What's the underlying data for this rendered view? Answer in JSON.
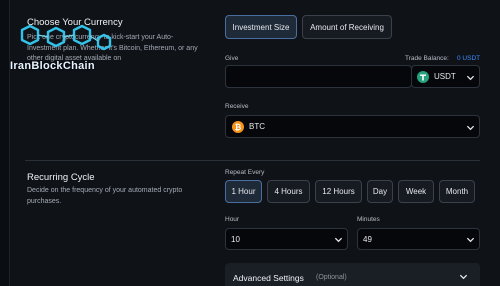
{
  "currency": {
    "title": "Choose Your Currency",
    "description": "Pick one cryptocurrency to kick-start your Auto-Investment plan. Whether it's Bitcoin, Ethereum, or any other digital asset available on"
  },
  "watermark": {
    "text": "IranBlockChain"
  },
  "tabs": [
    {
      "label": "Investment Size",
      "active": true
    },
    {
      "label": "Amount of Receiving",
      "active": false
    }
  ],
  "give": {
    "label": "Give",
    "value": "",
    "balance_label": "Trade Balance:",
    "balance_value": "0 USDT",
    "currency": "USDT",
    "currency_icon": "tether-icon",
    "currency_color": "#26a17b"
  },
  "receive": {
    "label": "Receive",
    "currency": "BTC",
    "currency_icon": "bitcoin-icon",
    "currency_color": "#f7931a"
  },
  "recurring": {
    "title": "Recurring Cycle",
    "description": "Decide on the frequency of your automated crypto purchases.",
    "repeat_label": "Repeat Every",
    "options": [
      "1 Hour",
      "4 Hours",
      "12 Hours",
      "Day",
      "Week",
      "Month"
    ],
    "selected": "1 Hour",
    "hour_label": "Hour",
    "hour_value": "10",
    "minutes_label": "Minutes",
    "minutes_value": "49"
  },
  "advanced": {
    "title": "Advanced Settings",
    "suffix": "(Optional)"
  },
  "colors": {
    "accent": "#3d8bff",
    "background": "#0f1318",
    "field": "#05070a",
    "border": "#2d333c"
  }
}
